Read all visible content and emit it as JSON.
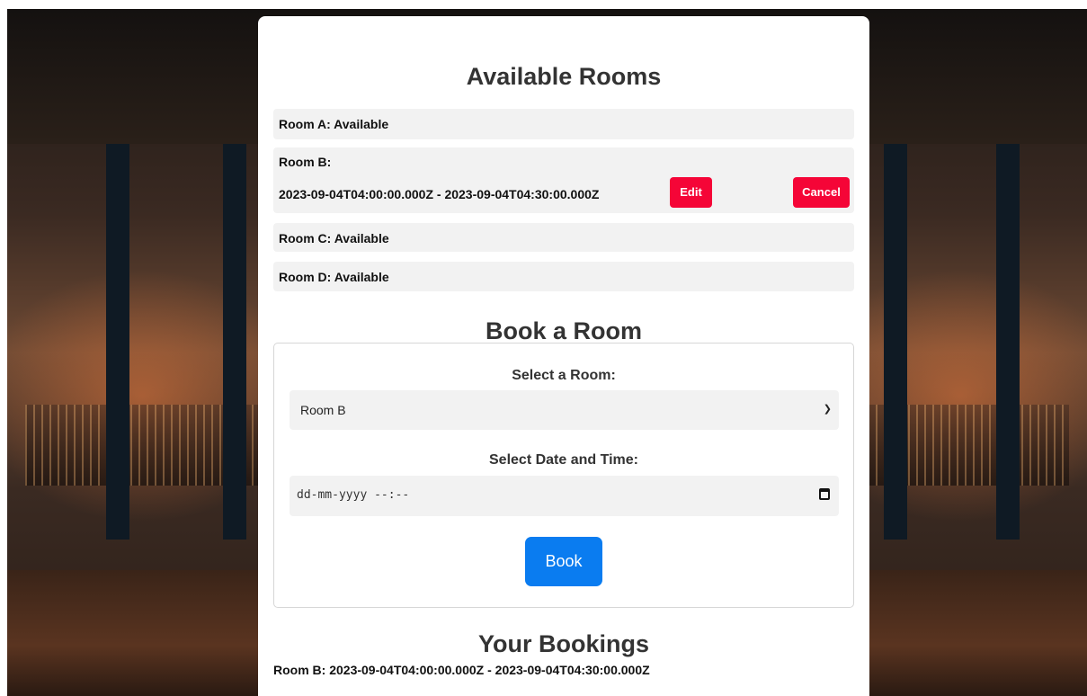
{
  "available": {
    "title": "Available Rooms",
    "rooms": [
      {
        "line": "Room A: Available"
      },
      {
        "line": "Room B:",
        "detail": "2023-09-04T04:00:00.000Z - 2023-09-04T04:30:00.000Z",
        "edit_label": "Edit",
        "cancel_label": "Cancel"
      },
      {
        "line": "Room C: Available"
      },
      {
        "line": "Room D: Available"
      }
    ]
  },
  "book": {
    "title": "Book a Room",
    "select_label": "Select a Room:",
    "selected_room": "Room B",
    "datetime_label": "Select Date and Time:",
    "datetime_placeholder": "dd-mm-yyyy --:--",
    "book_label": "Book"
  },
  "bookings": {
    "title": "Your Bookings",
    "items": [
      "Room B: 2023-09-04T04:00:00.000Z - 2023-09-04T04:30:00.000Z"
    ]
  },
  "icons": {
    "select": "chevron-down-icon",
    "date": "calendar-icon"
  },
  "colors": {
    "danger": "#f50537",
    "primary": "#0a7cf0",
    "row_bg": "#f2f2f2"
  }
}
